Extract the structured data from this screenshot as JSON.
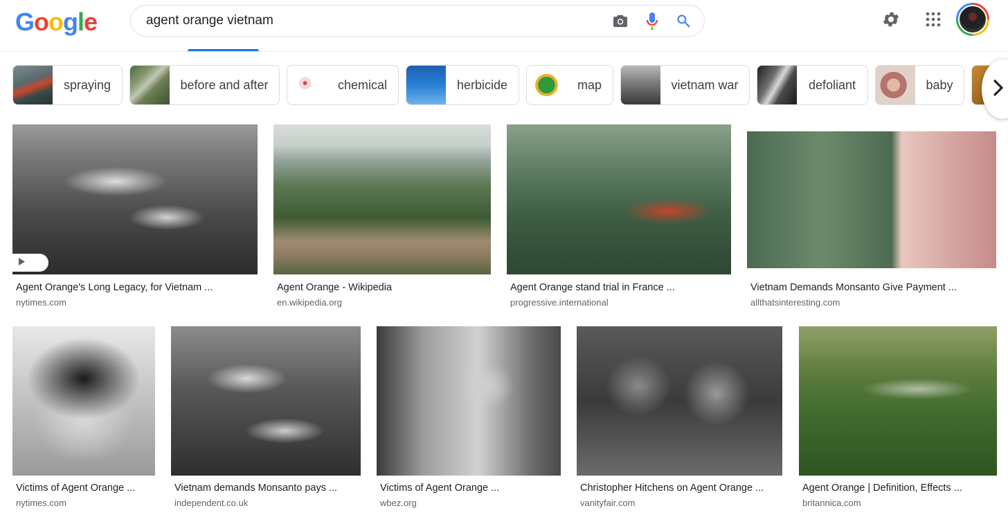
{
  "search": {
    "query": "agent orange vietnam"
  },
  "colors": {
    "google_blue": "#4285f4",
    "google_red": "#ea4335",
    "google_yellow": "#fbbc05",
    "google_green": "#34a853",
    "active_tab": "#1a73e8"
  },
  "icons": {
    "camera": "camera-icon",
    "mic": "microphone-icon",
    "search": "search-icon",
    "settings": "gear-icon",
    "apps": "apps-grid-icon",
    "next": "chevron-right-icon",
    "play": "play-icon"
  },
  "chips": [
    {
      "label": "spraying"
    },
    {
      "label": "before and after"
    },
    {
      "label": "chemical"
    },
    {
      "label": "herbicide"
    },
    {
      "label": "map"
    },
    {
      "label": "vietnam war"
    },
    {
      "label": "defoliant"
    },
    {
      "label": "baby"
    }
  ],
  "results_row1": [
    {
      "title": "Agent Orange's Long Legacy, for Vietnam ...",
      "source": "nytimes.com"
    },
    {
      "title": "Agent Orange - Wikipedia",
      "source": "en.wikipedia.org"
    },
    {
      "title": "Agent Orange stand trial in France ...",
      "source": "progressive.international"
    },
    {
      "title": "Vietnam Demands Monsanto Give Payment ...",
      "source": "allthatsinteresting.com"
    }
  ],
  "results_row2": [
    {
      "title": "Victims of Agent Orange ...",
      "source": "nytimes.com"
    },
    {
      "title": "Vietnam demands Monsanto pays ...",
      "source": "independent.co.uk"
    },
    {
      "title": "Victims of Agent Orange ...",
      "source": "wbez.org"
    },
    {
      "title": "Christopher Hitchens on Agent Orange ...",
      "source": "vanityfair.com"
    },
    {
      "title": "Agent Orange | Definition, Effects ...",
      "source": "britannica.com"
    }
  ]
}
